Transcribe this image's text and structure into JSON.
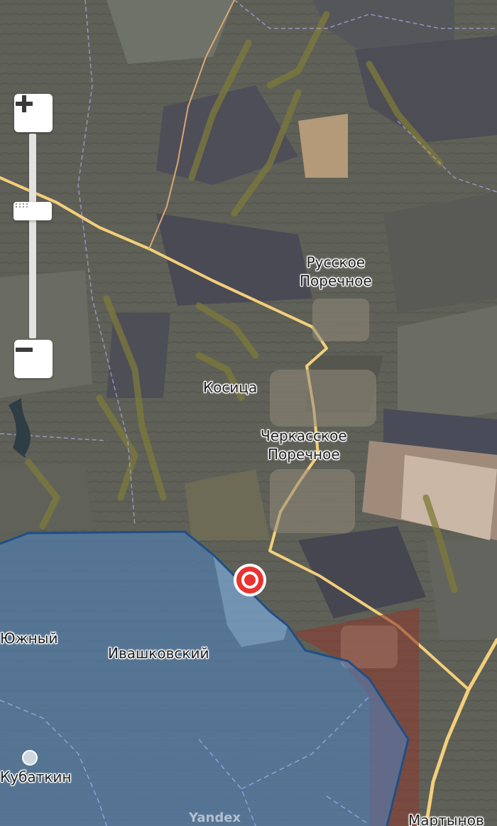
{
  "map": {
    "places": [
      {
        "id": "russkoe-porechnoe",
        "lines": [
          "Русское",
          "Поречное"
        ]
      },
      {
        "id": "kositsa",
        "lines": [
          "Косица"
        ]
      },
      {
        "id": "cherkasskoe-porechnoe",
        "lines": [
          "Черкасское",
          "Поречное"
        ]
      },
      {
        "id": "yuzhny",
        "lines": [
          "Южный"
        ]
      },
      {
        "id": "ivashkovsky",
        "lines": [
          "Ивашковский"
        ]
      },
      {
        "id": "kubatkin",
        "lines": [
          "Кубаткин"
        ]
      },
      {
        "id": "martynovka",
        "lines": [
          "Мартынов"
        ]
      }
    ],
    "watermark": "Yandex",
    "colors": {
      "terrain": "#5e6057",
      "road": "#f3cf7a",
      "controlled_area_fill": "#4f86c6",
      "controlled_area_border": "#1f4f86",
      "contested_area_fill": "#8a3a2e",
      "marker": "#e8332f"
    }
  },
  "controls": {
    "zoom_in_icon": "plus-icon",
    "zoom_out_icon": "minus-icon",
    "zoom_handle_icon": "grip-icon",
    "zoom_level": 0.66
  }
}
